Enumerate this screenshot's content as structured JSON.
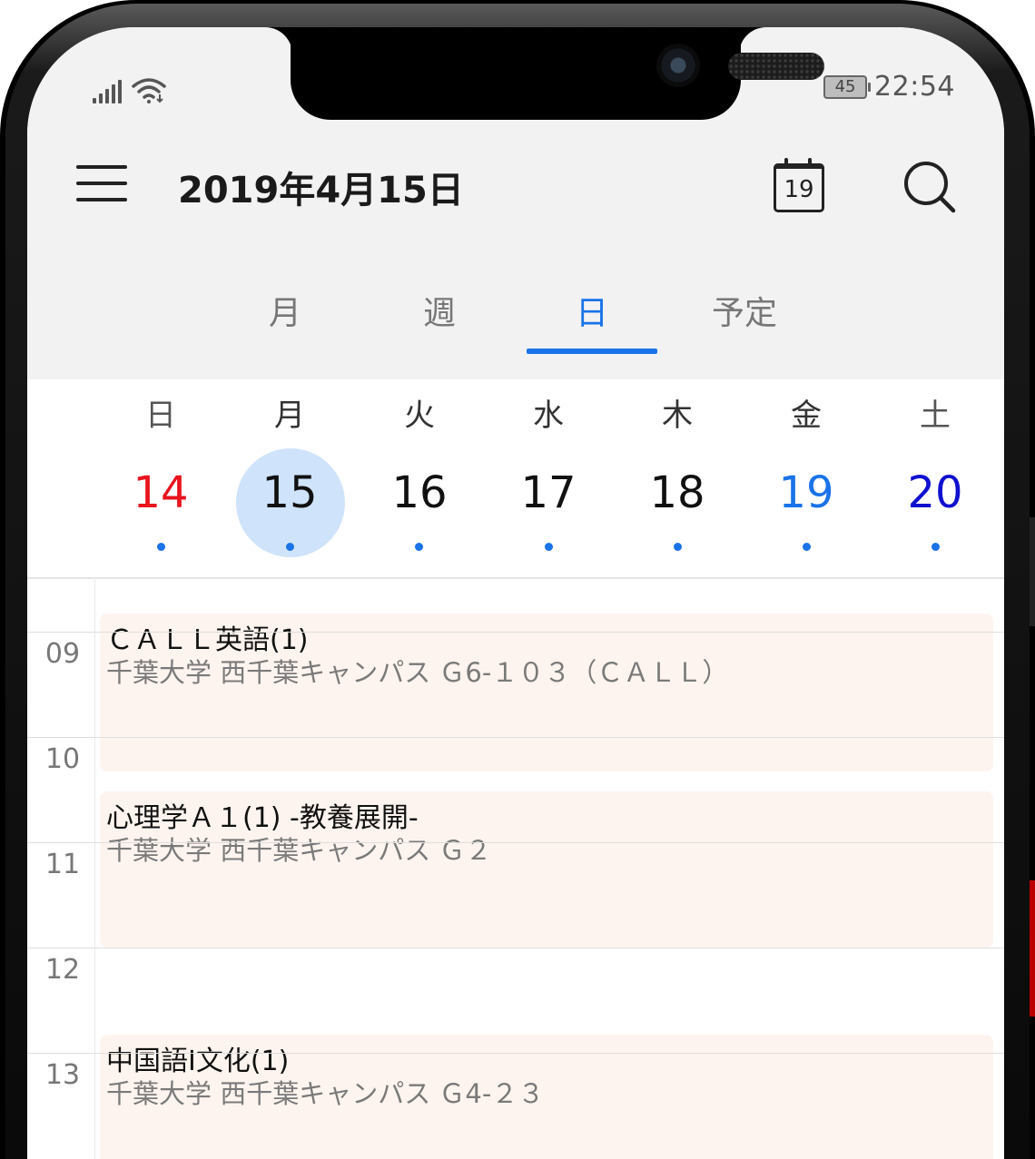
{
  "status_bar": {
    "battery": "45",
    "time": "22:54"
  },
  "header": {
    "title": "2019年4月15日",
    "today_icon_num": "19"
  },
  "view_tabs": [
    {
      "label": "月",
      "active": false
    },
    {
      "label": "週",
      "active": false
    },
    {
      "label": "日",
      "active": true
    },
    {
      "label": "予定",
      "active": false
    }
  ],
  "week": {
    "weekdays": [
      "日",
      "月",
      "火",
      "水",
      "木",
      "金",
      "土"
    ],
    "days": [
      {
        "num": "14",
        "color": "#e8141e"
      },
      {
        "num": "15",
        "color": "#111111",
        "selected": true
      },
      {
        "num": "16",
        "color": "#111111"
      },
      {
        "num": "17",
        "color": "#111111"
      },
      {
        "num": "18",
        "color": "#111111"
      },
      {
        "num": "19",
        "color": "#1a73e8"
      },
      {
        "num": "20",
        "color": "#1010d0"
      }
    ]
  },
  "timeline": {
    "hours": [
      "09",
      "10",
      "11",
      "12",
      "13"
    ]
  },
  "events": [
    {
      "title": "ＣＡＬＬ英語(1)",
      "location": "千葉大学 西千葉キャンパス Ｇ6-１０３（ＣＡＬＬ）"
    },
    {
      "title": "心理学Ａ１(1) -教養展開-",
      "location": "千葉大学 西千葉キャンパス Ｇ２"
    },
    {
      "title": "中国語I文化(1)",
      "location": "千葉大学 西千葉キャンパス Ｇ4-２３"
    }
  ],
  "colors": {
    "accent": "#1a73e8",
    "selected_day_bg": "#cfe3fa",
    "event_bg": "#fef4ef"
  }
}
